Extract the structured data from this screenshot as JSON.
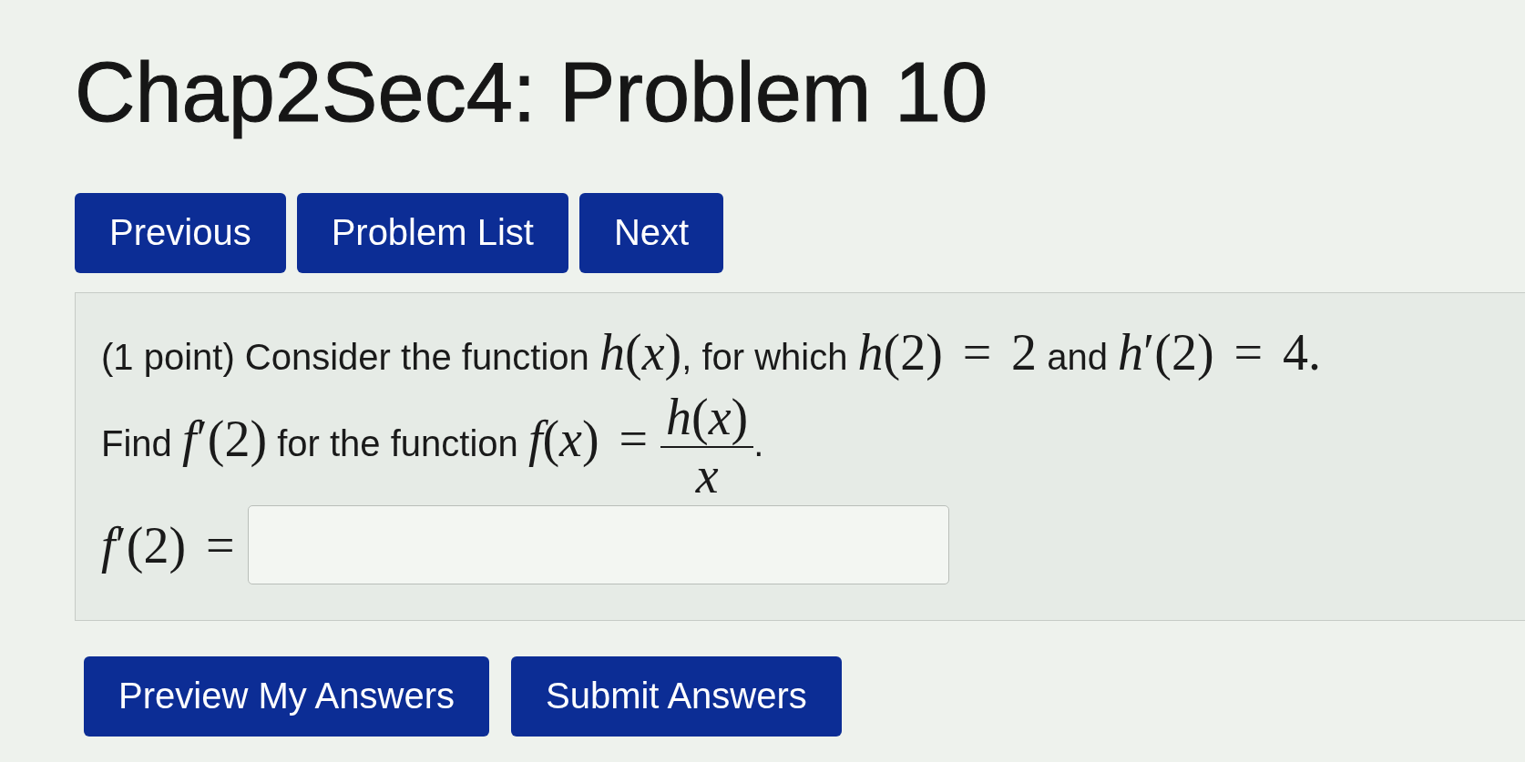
{
  "title": "Chap2Sec4: Problem 10",
  "nav_buttons": [
    {
      "label": "Previous"
    },
    {
      "label": "Problem List"
    },
    {
      "label": "Next"
    }
  ],
  "problem": {
    "lines": [
      [
        {
          "kind": "text",
          "text": "(1 point) Consider the function "
        },
        {
          "kind": "math",
          "text": "*h*(*x*)"
        },
        {
          "kind": "text",
          "text": ", for which "
        },
        {
          "kind": "math",
          "text": "*h*(2) = 2"
        },
        {
          "kind": "text",
          "text": " and "
        },
        {
          "kind": "math",
          "text": "*h*′(2) = 4."
        }
      ],
      [
        {
          "kind": "text",
          "text": "Find "
        },
        {
          "kind": "math",
          "text": "*f*′(2)"
        },
        {
          "kind": "text",
          "text": " for the function "
        },
        {
          "kind": "math",
          "text": "*f*(*x*) ="
        },
        {
          "kind": "fraction",
          "numerator": "*h*(*x*)",
          "denominator": "*x*"
        },
        {
          "kind": "text",
          "text": "."
        }
      ]
    ],
    "answer": {
      "label": "*f*′(2) ="
    }
  },
  "action_buttons": [
    {
      "label": "Preview My Answers"
    },
    {
      "label": "Submit Answers"
    }
  ]
}
